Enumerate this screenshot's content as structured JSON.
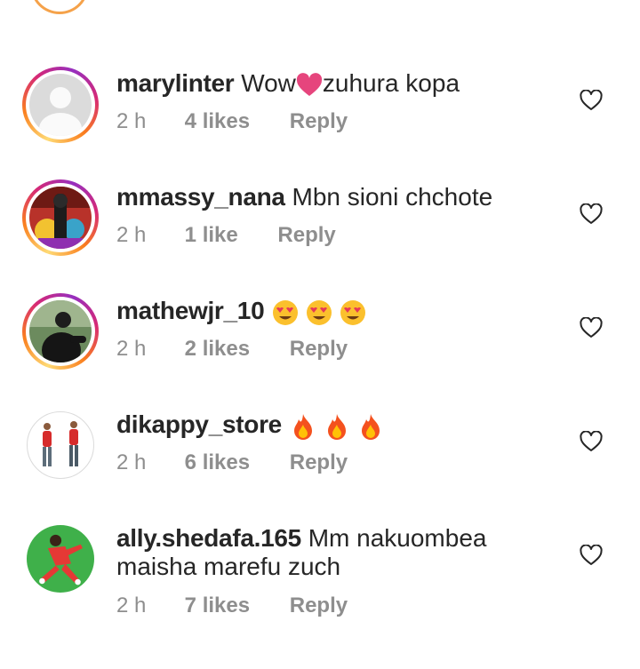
{
  "comments": [
    {
      "username": "marylinter",
      "text_before": "Wow",
      "text_after": "zuhura kopa",
      "inline_icon": "heart-emoji",
      "time": "2 h",
      "likes": "4 likes",
      "reply": "Reply",
      "like_icon": "heart-outline-icon"
    },
    {
      "username": "mmassy_nana",
      "text": "Mbn sioni chchote",
      "time": "2 h",
      "likes": "1 like",
      "reply": "Reply",
      "like_icon": "heart-outline-icon"
    },
    {
      "username": "mathewjr_10",
      "emojis": [
        "heart-eyes-emoji",
        "heart-eyes-emoji",
        "heart-eyes-emoji"
      ],
      "time": "2 h",
      "likes": "2 likes",
      "reply": "Reply",
      "like_icon": "heart-outline-icon"
    },
    {
      "username": "dikappy_store",
      "emojis": [
        "fire-emoji",
        "fire-emoji",
        "fire-emoji"
      ],
      "time": "2 h",
      "likes": "6 likes",
      "reply": "Reply",
      "like_icon": "heart-outline-icon"
    },
    {
      "username": "ally.shedafa.165",
      "text_line1": "Mm nakuombea",
      "text_line2": "maisha marefu zuch",
      "time": "2 h",
      "likes": "7 likes",
      "reply": "Reply",
      "like_icon": "heart-outline-icon"
    }
  ],
  "colors": {
    "text": "#262626",
    "secondary": "#8e8e8e",
    "heart_emoji": "#e6457d",
    "story_ring": [
      "#feda75",
      "#fa7e1e",
      "#d62976",
      "#962fbf"
    ]
  }
}
